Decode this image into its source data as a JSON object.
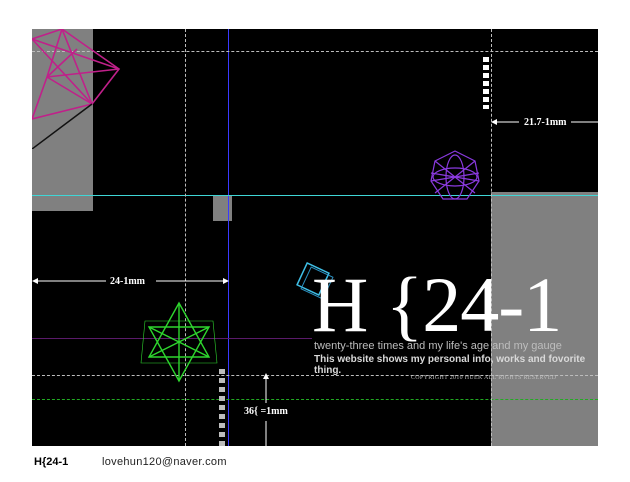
{
  "canvas": {
    "measure_right": "21.7-1mm",
    "measure_left": "24-1mm",
    "measure_bottom": "36{ =1mm",
    "title": "H {24-1",
    "tagline": "twenty-three times and my life's age and my gauge",
    "subtitle": "This website shows my personal info, works and fovorite thing.",
    "copyright": "COPYRIGHT 2010 HUEK ALL RIGHTS RESERVED"
  },
  "footer": {
    "brand": "H{24-1",
    "email": "lovehun120@naver.com"
  },
  "icons": {
    "magenta_geometric": "magenta-polyhedron-icon",
    "purple_geometric": "purple-wireframe-sphere-icon",
    "green_geometric": "green-star-polyhedron-icon",
    "cyan_square": "cyan-rotated-square-icon"
  },
  "colors": {
    "background": "#000000",
    "panel_gray": "#808080",
    "guide_cyan": "#3fd6d6",
    "guide_blue": "#3a3aff",
    "guide_green": "#22aa22",
    "magenta": "#c0208a",
    "purple": "#8a3adf",
    "green": "#2ed62e"
  }
}
